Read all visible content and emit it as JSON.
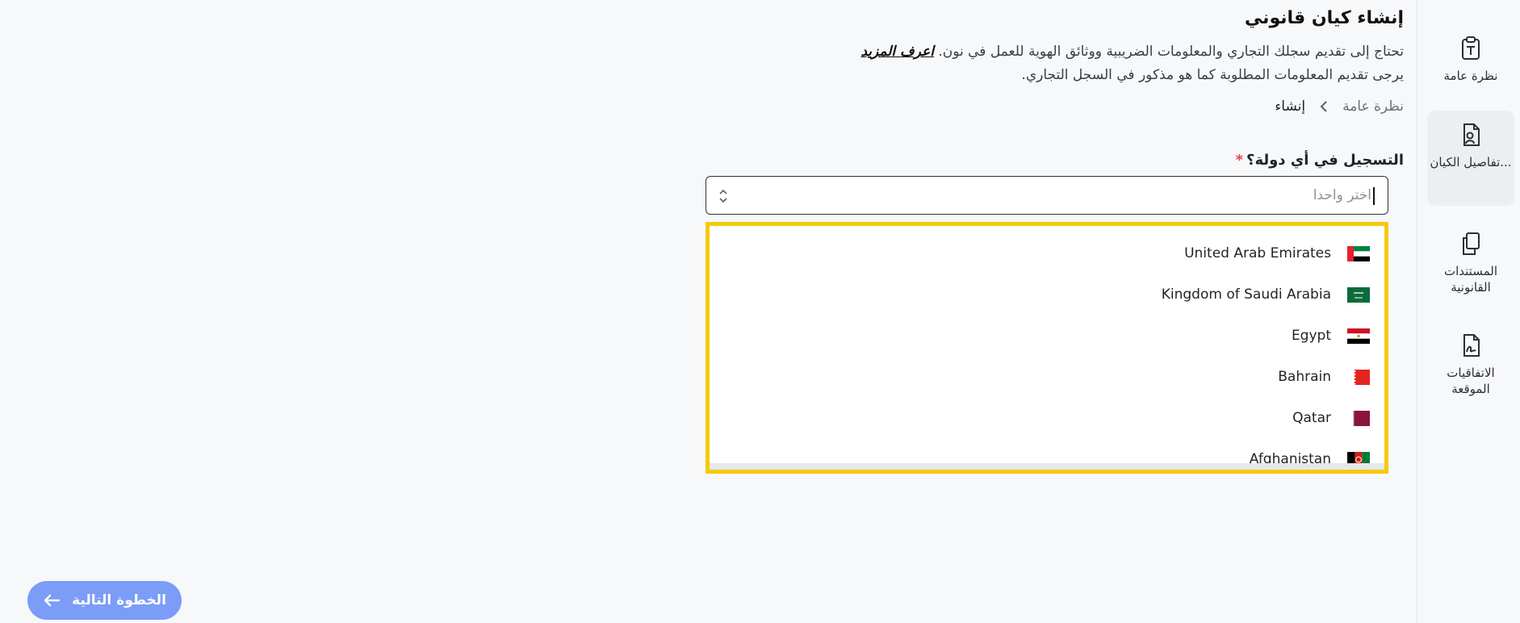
{
  "sidebar": {
    "items": [
      {
        "label": "نظرة عامة",
        "icon": "clipboard-text-icon",
        "active": false
      },
      {
        "label": "تفاصيل الكيان...",
        "icon": "document-user-icon",
        "active": true
      },
      {
        "label": "المستندات القانونية",
        "icon": "documents-copy-icon",
        "active": false
      },
      {
        "label": "الاتفاقيات الموقعة",
        "icon": "document-signature-icon",
        "active": false
      }
    ]
  },
  "header": {
    "title": "إنشاء كيان قانوني",
    "description_line1": "تحتاج إلى تقديم سجلك التجاري والمعلومات الضريبية ووثائق الهوية للعمل في نون.",
    "learn_more": "اعرف المزيد",
    "description_line2": "يرجى تقديم المعلومات المطلوبة كما هو مذكور في السجل التجاري."
  },
  "breadcrumb": {
    "items": [
      "نظرة عامة",
      "إنشاء"
    ]
  },
  "form": {
    "country_label": "التسجيل في أي دولة؟",
    "required_mark": "*",
    "select_placeholder": "اختر واحدا"
  },
  "dropdown": {
    "options": [
      {
        "name": "United Arab Emirates",
        "flag": "uae-flag-icon"
      },
      {
        "name": "Kingdom of Saudi Arabia",
        "flag": "saudi-flag-icon"
      },
      {
        "name": "Egypt",
        "flag": "egypt-flag-icon"
      },
      {
        "name": "Bahrain",
        "flag": "bahrain-flag-icon"
      },
      {
        "name": "Qatar",
        "flag": "qatar-flag-icon"
      },
      {
        "name": "Afghanistan",
        "flag": "afghanistan-flag-icon"
      }
    ]
  },
  "footer": {
    "next_label": "الخطوة التالية"
  },
  "colors": {
    "highlight": "#f6c90e",
    "primary_button": "#7b9cf7",
    "required": "#e0464e"
  }
}
